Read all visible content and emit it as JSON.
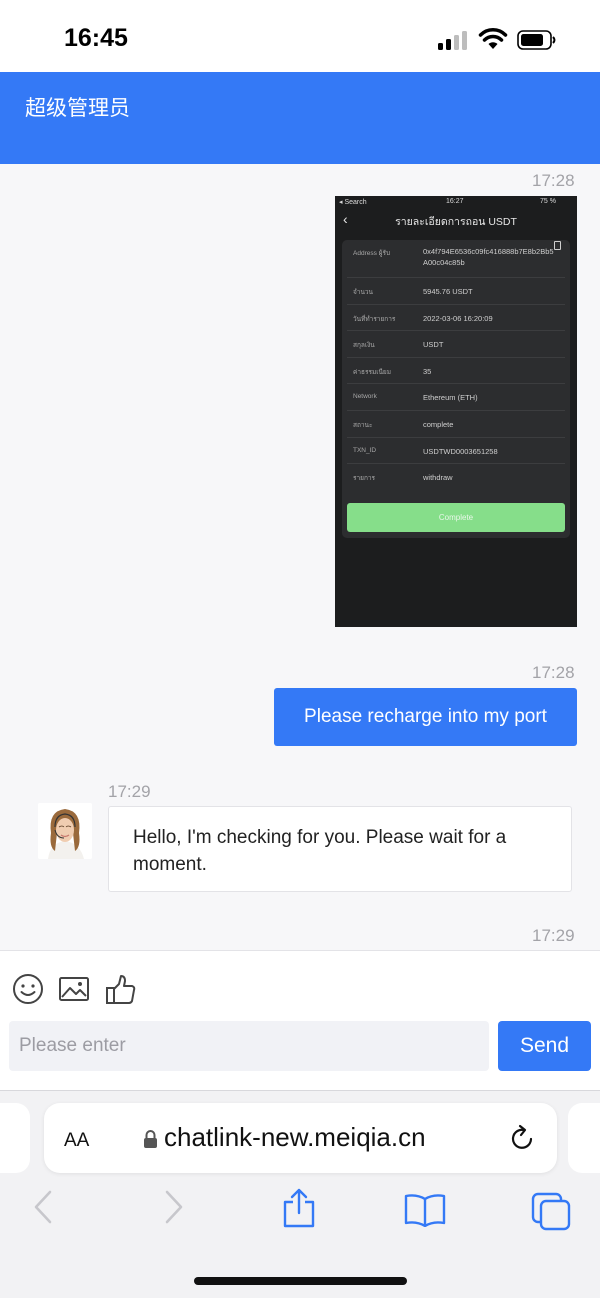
{
  "status_bar": {
    "time": "16:45"
  },
  "header": {
    "title": "超级管理员"
  },
  "messages": {
    "t1": "17:28",
    "screenshot": {
      "status_left": "◂ Search",
      "status_time": "16:27",
      "status_right": "75 %",
      "title": "รายละเอียดการถอน USDT",
      "rows": [
        {
          "label": "Address ผู้รับ",
          "value": "0x4f794E6536c09fc416888b7E8b2Bb5A00c04c85b"
        },
        {
          "label": "จำนวน",
          "value": "5945.76 USDT"
        },
        {
          "label": "วันที่ทำรายการ",
          "value": "2022-03-06 16:20:09"
        },
        {
          "label": "สกุลเงิน",
          "value": "USDT"
        },
        {
          "label": "ค่าธรรมเนียม",
          "value": "35"
        },
        {
          "label": "Network",
          "value": "Ethereum (ETH)"
        },
        {
          "label": "สถานะ",
          "value": "complete"
        },
        {
          "label": "TXN_ID",
          "value": "USDTWD0003651258"
        },
        {
          "label": "รายการ",
          "value": "withdraw"
        }
      ],
      "button": "Complete"
    },
    "t2": "17:28",
    "outgoing_text": "Please recharge into my port",
    "t3": "17:29",
    "incoming_text": "Hello, I'm checking for you. Please wait for a moment.",
    "t4": "17:29"
  },
  "composer": {
    "placeholder": "Please enter",
    "send_label": "Send",
    "icons": [
      "emoji-icon",
      "image-icon",
      "thumbs-up-icon"
    ]
  },
  "browser": {
    "text_size_label": "AA",
    "url": "chatlink-new.meiqia.cn"
  },
  "colors": {
    "accent": "#3479f6",
    "complete_green": "#86de8a"
  }
}
